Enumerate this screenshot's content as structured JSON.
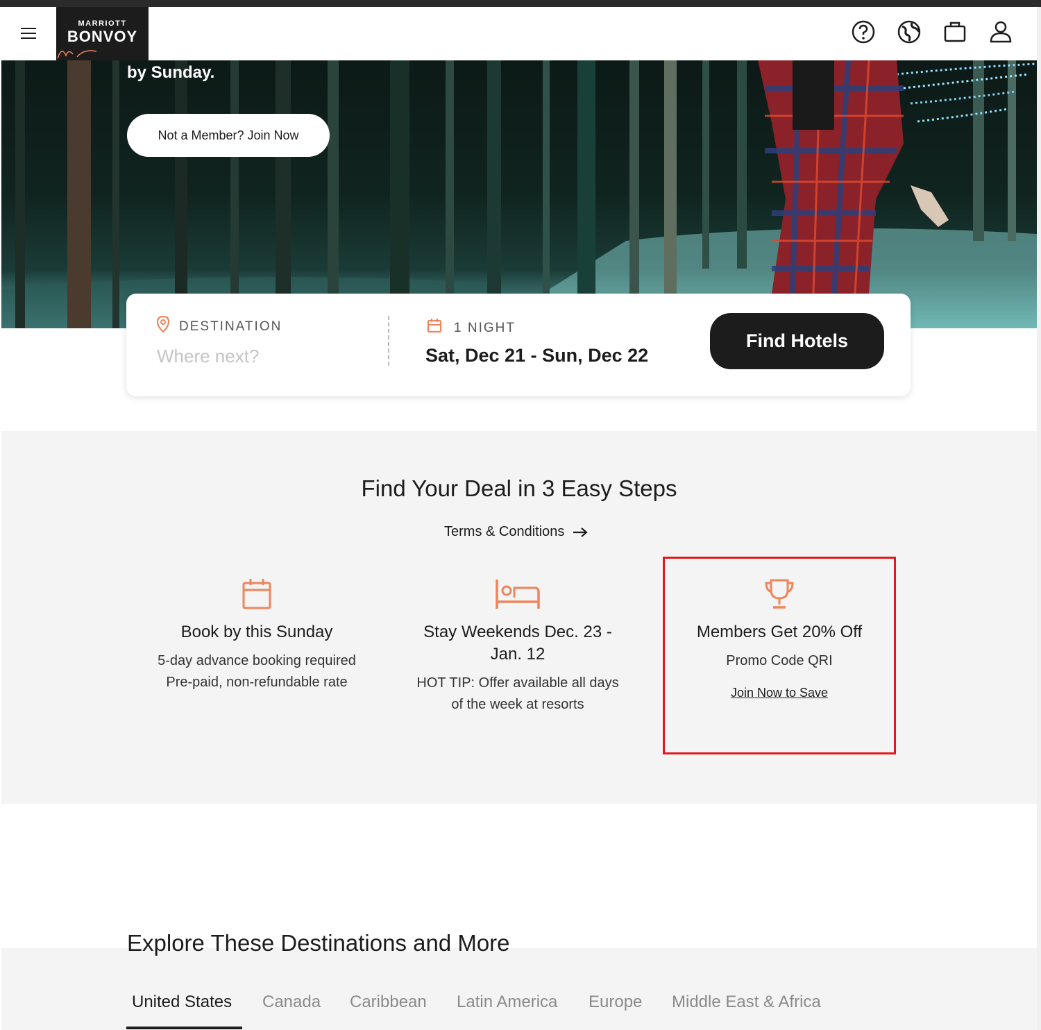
{
  "header": {
    "brand_top": "MARRIOTT",
    "brand_main": "BONVOY",
    "icons": [
      "help-icon",
      "globe-icon",
      "suitcase-icon",
      "account-icon"
    ]
  },
  "hero": {
    "text": "by Sunday.",
    "join_button": "Not a Member? Join Now"
  },
  "search": {
    "destination_label": "DESTINATION",
    "destination_placeholder": "Where next?",
    "nights_label": "1 NIGHT",
    "dates": "Sat, Dec 21 - Sun, Dec 22",
    "find_button": "Find Hotels"
  },
  "steps": {
    "title": "Find Your Deal in 3 Easy Steps",
    "terms": "Terms & Conditions",
    "items": [
      {
        "icon": "calendar-icon",
        "title": "Book by this Sunday",
        "desc": "5-day advance booking required Pre-paid, non-refundable rate"
      },
      {
        "icon": "bed-icon",
        "title": "Stay Weekends Dec. 23 - Jan. 12",
        "desc": "HOT TIP: Offer available all days of the week at resorts"
      },
      {
        "icon": "trophy-icon",
        "title": "Members Get 20% Off",
        "desc": "Promo Code QRI",
        "link": "Join Now to Save"
      }
    ]
  },
  "explore": {
    "title": "Explore These Destinations and More",
    "tabs": [
      "United States",
      "Canada",
      "Caribbean",
      "Latin America",
      "Europe",
      "Middle East & Africa"
    ],
    "active_tab": "United States"
  },
  "colors": {
    "accent": "#f0845b",
    "dark": "#1c1c1c",
    "highlight": "#e0191e"
  }
}
